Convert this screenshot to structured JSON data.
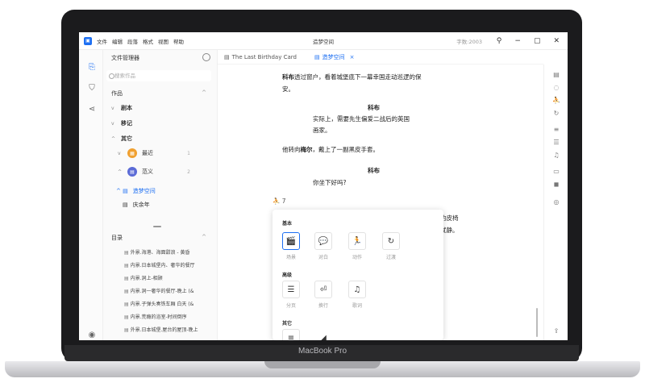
{
  "device": {
    "brand": "MacBook Pro"
  },
  "app": {
    "menu": [
      "文件",
      "编辑",
      "段落",
      "格式",
      "视图",
      "帮助"
    ],
    "window_title": "造梦空间",
    "word_count": "字数:2003",
    "window_controls": [
      "⚲",
      "−",
      "▢",
      "✕"
    ]
  },
  "sidebar": {
    "title": "文件管理器",
    "search_placeholder": "搜索作品",
    "works_label": "作品",
    "items": [
      {
        "label": "剧本"
      },
      {
        "label": "移记"
      },
      {
        "label": "其它"
      }
    ],
    "sub_items": [
      {
        "label": "最近",
        "count": "1"
      },
      {
        "label": "范义",
        "count": "2"
      }
    ],
    "active_doc": "造梦空间",
    "other_doc": "庆余年",
    "outline_label": "目录",
    "outline": [
      "外景.海港、海面甜浪 - 黄昏",
      "内景.日本城堡内、奢华的餐厅",
      "内景.洞上-相顾",
      "内景.洞一奢华的餐厅-晚上 (&",
      "内景.子弹头奏铁车厢 白天 (&",
      "内景.荒瘾的浴室-时间倒序",
      "外景.日本城堡.屋台的屋顶-晚上"
    ]
  },
  "tabs": [
    {
      "label": "The Last Birthday Card",
      "active": false
    },
    {
      "label": "造梦空间",
      "active": true
    }
  ],
  "editor": {
    "line1a": "科布",
    "line1b": "透过窗户，看着城堡底下一幕幸国走动巡逻的保",
    "line2": "安。",
    "char1": "科布",
    "dialog1a": "实际上，需要先生偏爱二战后的英国",
    "dialog1b": "画家。",
    "action2a": "他转向",
    "action2b": "梅尔",
    "action2c": "，戴上了一副黑皮手套。",
    "char2": "科布",
    "dialog2": "你坐下好吗?",
    "cursor_line": "⛹ 7",
    "frag1": "的皮椅",
    "frag2": "就静。"
  },
  "popup": {
    "sections": [
      "基本",
      "高级",
      "其它"
    ],
    "basic": [
      {
        "icon": "🎬",
        "label": "场景"
      },
      {
        "icon": "💬",
        "label": "对白"
      },
      {
        "icon": "🏃",
        "label": "动作"
      },
      {
        "icon": "↻",
        "label": "过渡"
      }
    ],
    "advanced": [
      {
        "icon": "☰",
        "label": "分页"
      },
      {
        "icon": "⏎",
        "label": "换行"
      },
      {
        "icon": "♫",
        "label": "歌词"
      }
    ],
    "other": [
      {
        "icon": "≡",
        "label": ""
      },
      {
        "icon": "◢",
        "label": ""
      }
    ]
  },
  "colors": {
    "accent": "#1d6ff2",
    "recent_badge": "#f0a030",
    "alt_badge": "#5b6bd6"
  }
}
